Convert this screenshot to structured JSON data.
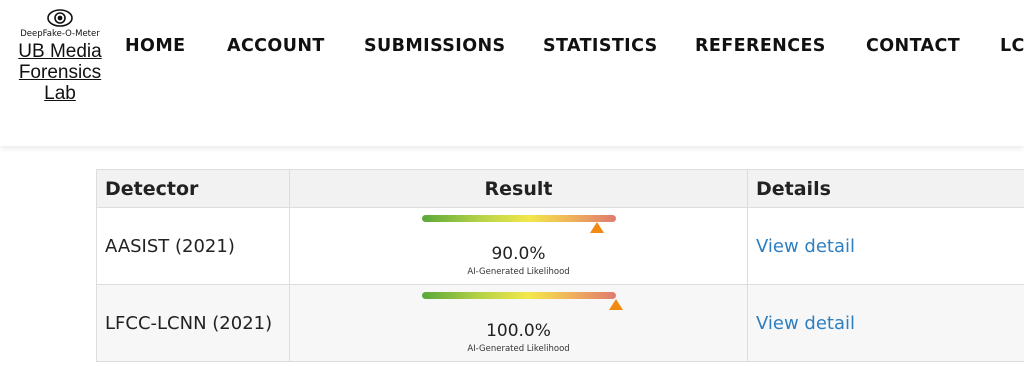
{
  "header": {
    "logo_text": "DeepFake-O-Meter",
    "lab_link": "UB Media Forensics Lab",
    "nav": [
      {
        "label": "HOME"
      },
      {
        "label": "ACCOUNT"
      },
      {
        "label": "SUBMISSIONS"
      },
      {
        "label": "STATISTICS"
      },
      {
        "label": "REFERENCES"
      },
      {
        "label": "CONTACT"
      },
      {
        "label": "LC"
      }
    ]
  },
  "table": {
    "headers": {
      "detector": "Detector",
      "result": "Result",
      "details": "Details"
    },
    "rows": [
      {
        "detector": "AASIST (2021)",
        "percent": "90.0%",
        "likelihood_value": 0.9,
        "likelihood_label": "AI-Generated Likelihood",
        "details_link": "View detail"
      },
      {
        "detector": "LFCC-LCNN (2021)",
        "percent": "100.0%",
        "likelihood_value": 1.0,
        "likelihood_label": "AI-Generated Likelihood",
        "details_link": "View detail"
      }
    ]
  },
  "colors": {
    "link": "#2d7fc1",
    "marker": "#f08a12",
    "header_bg": "#f2f2f2"
  }
}
